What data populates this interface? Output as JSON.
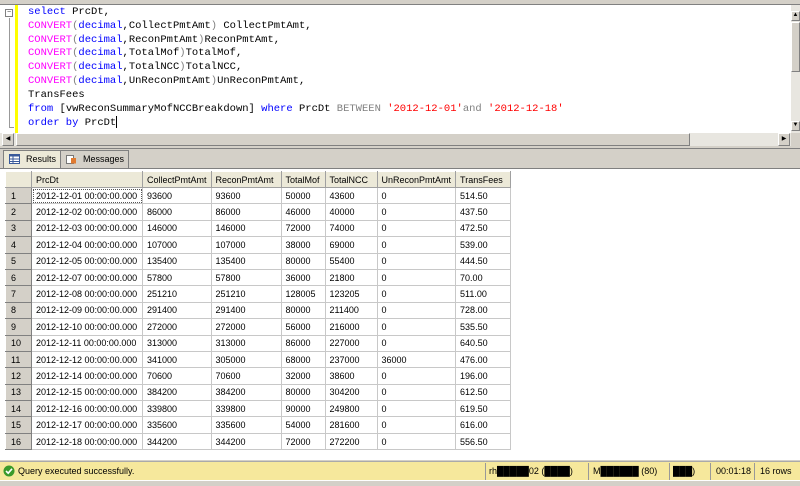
{
  "editor": {
    "lines": [
      [
        [
          "select",
          "k"
        ],
        [
          " PrcDt,",
          "t"
        ]
      ],
      [
        [
          "CONVERT",
          "f"
        ],
        [
          "(",
          "o"
        ],
        [
          "decimal",
          "k"
        ],
        [
          ",CollectPmtAmt",
          "t"
        ],
        [
          ")",
          "o"
        ],
        [
          " CollectPmtAmt,",
          "t"
        ]
      ],
      [
        [
          "CONVERT",
          "f"
        ],
        [
          "(",
          "o"
        ],
        [
          "decimal",
          "k"
        ],
        [
          ",ReconPmtAmt",
          "t"
        ],
        [
          ")",
          "o"
        ],
        [
          "ReconPmtAmt,",
          "t"
        ]
      ],
      [
        [
          "CONVERT",
          "f"
        ],
        [
          "(",
          "o"
        ],
        [
          "decimal",
          "k"
        ],
        [
          ",TotalMof",
          "t"
        ],
        [
          ")",
          "o"
        ],
        [
          "TotalMof,",
          "t"
        ]
      ],
      [
        [
          "CONVERT",
          "f"
        ],
        [
          "(",
          "o"
        ],
        [
          "decimal",
          "k"
        ],
        [
          ",TotalNCC",
          "t"
        ],
        [
          ")",
          "o"
        ],
        [
          "TotalNCC,",
          "t"
        ]
      ],
      [
        [
          "CONVERT",
          "f"
        ],
        [
          "(",
          "o"
        ],
        [
          "decimal",
          "k"
        ],
        [
          ",UnReconPmtAmt",
          "t"
        ],
        [
          ")",
          "o"
        ],
        [
          "UnReconPmtAmt,",
          "t"
        ]
      ],
      [
        [
          "TransFees",
          "t"
        ]
      ],
      [
        [
          "from",
          "k"
        ],
        [
          " [vwReconSummaryMofNCCBreakdown] ",
          "t"
        ],
        [
          "where",
          "k"
        ],
        [
          " PrcDt ",
          "t"
        ],
        [
          "BETWEEN",
          "o"
        ],
        [
          " ",
          "t"
        ],
        [
          "'2012-12-01'",
          "s"
        ],
        [
          "and",
          "o"
        ],
        [
          " ",
          "t"
        ],
        [
          "'2012-12-18'",
          "s"
        ]
      ],
      [
        [
          "order by",
          "k"
        ],
        [
          " PrcDt",
          "t"
        ]
      ]
    ]
  },
  "result_tabs": {
    "results": "Results",
    "messages": "Messages"
  },
  "grid": {
    "columns": [
      "PrcDt",
      "CollectPmtAmt",
      "ReconPmtAmt",
      "TotalMof",
      "TotalNCC",
      "UnReconPmtAmt",
      "TransFees"
    ],
    "rows": [
      [
        "1",
        "2012-12-01 00:00:00.000",
        "93600",
        "93600",
        "50000",
        "43600",
        "0",
        "514.50"
      ],
      [
        "2",
        "2012-12-02 00:00:00.000",
        "86000",
        "86000",
        "46000",
        "40000",
        "0",
        "437.50"
      ],
      [
        "3",
        "2012-12-03 00:00:00.000",
        "146000",
        "146000",
        "72000",
        "74000",
        "0",
        "472.50"
      ],
      [
        "4",
        "2012-12-04 00:00:00.000",
        "107000",
        "107000",
        "38000",
        "69000",
        "0",
        "539.00"
      ],
      [
        "5",
        "2012-12-05 00:00:00.000",
        "135400",
        "135400",
        "80000",
        "55400",
        "0",
        "444.50"
      ],
      [
        "6",
        "2012-12-07 00:00:00.000",
        "57800",
        "57800",
        "36000",
        "21800",
        "0",
        "70.00"
      ],
      [
        "7",
        "2012-12-08 00:00:00.000",
        "251210",
        "251210",
        "128005",
        "123205",
        "0",
        "511.00"
      ],
      [
        "8",
        "2012-12-09 00:00:00.000",
        "291400",
        "291400",
        "80000",
        "211400",
        "0",
        "728.00"
      ],
      [
        "9",
        "2012-12-10 00:00:00.000",
        "272000",
        "272000",
        "56000",
        "216000",
        "0",
        "535.50"
      ],
      [
        "10",
        "2012-12-11 00:00:00.000",
        "313000",
        "313000",
        "86000",
        "227000",
        "0",
        "640.50"
      ],
      [
        "11",
        "2012-12-12 00:00:00.000",
        "341000",
        "305000",
        "68000",
        "237000",
        "36000",
        "476.00"
      ],
      [
        "12",
        "2012-12-14 00:00:00.000",
        "70600",
        "70600",
        "32000",
        "38600",
        "0",
        "196.00"
      ],
      [
        "13",
        "2012-12-15 00:00:00.000",
        "384200",
        "384200",
        "80000",
        "304200",
        "0",
        "612.50"
      ],
      [
        "14",
        "2012-12-16 00:00:00.000",
        "339800",
        "339800",
        "90000",
        "249800",
        "0",
        "619.50"
      ],
      [
        "15",
        "2012-12-17 00:00:00.000",
        "335600",
        "335600",
        "54000",
        "281600",
        "0",
        "616.00"
      ],
      [
        "16",
        "2012-12-18 00:00:00.000",
        "344200",
        "344200",
        "72000",
        "272200",
        "0",
        "556.50"
      ]
    ]
  },
  "status": {
    "message": "Query executed successfully.",
    "server": "rh█████02 (████)",
    "user": "M██████ (80)",
    "database": "███)",
    "elapsed": "00:01:18",
    "rows": "16 rows",
    "color": "#f6e89c"
  }
}
